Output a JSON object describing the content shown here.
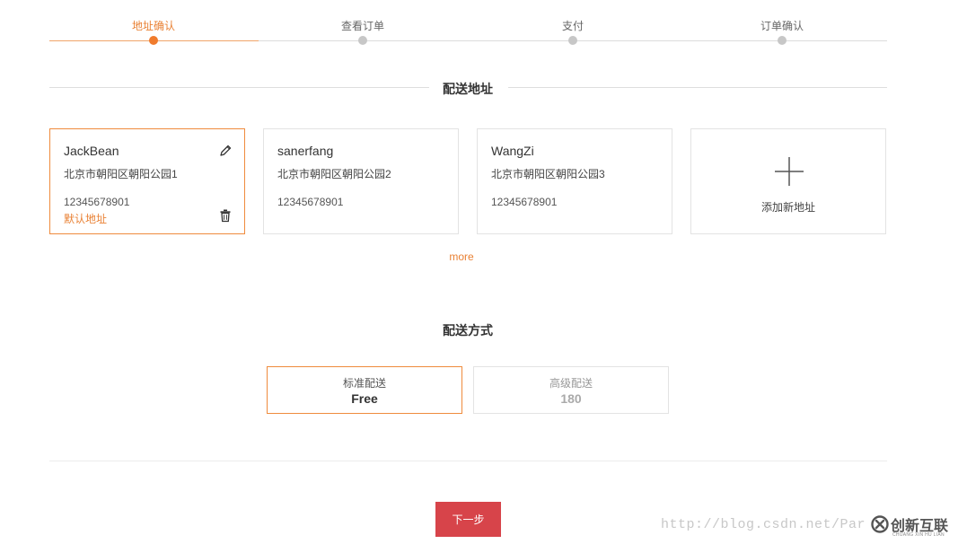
{
  "steps": [
    {
      "label": "地址确认",
      "active": true
    },
    {
      "label": "查看订单",
      "active": false
    },
    {
      "label": "支付",
      "active": false
    },
    {
      "label": "订单确认",
      "active": false
    }
  ],
  "address_section": {
    "title": "配送地址"
  },
  "addresses": [
    {
      "name": "JackBean",
      "address": "北京市朝阳区朝阳公园1",
      "phone": "12345678901",
      "default_label": "默认地址"
    },
    {
      "name": "sanerfang",
      "address": "北京市朝阳区朝阳公园2",
      "phone": "12345678901"
    },
    {
      "name": "WangZi",
      "address": "北京市朝阳区朝阳公园3",
      "phone": "12345678901"
    }
  ],
  "add_address": {
    "label": "添加新地址"
  },
  "more_link": "more",
  "shipping_section": {
    "title": "配送方式"
  },
  "shipping_options": [
    {
      "name": "标准配送",
      "price": "Free"
    },
    {
      "name": "高级配送",
      "price": "180"
    }
  ],
  "next_button": "下一步",
  "watermark": {
    "url": "http://blog.csdn.net/Par",
    "brand": "创新互联",
    "brand_sub": "CHUANG XIN HU LIAN"
  },
  "colors": {
    "accent": "#f07b2c",
    "button": "#d7444a",
    "border": "#e3e3e3"
  }
}
